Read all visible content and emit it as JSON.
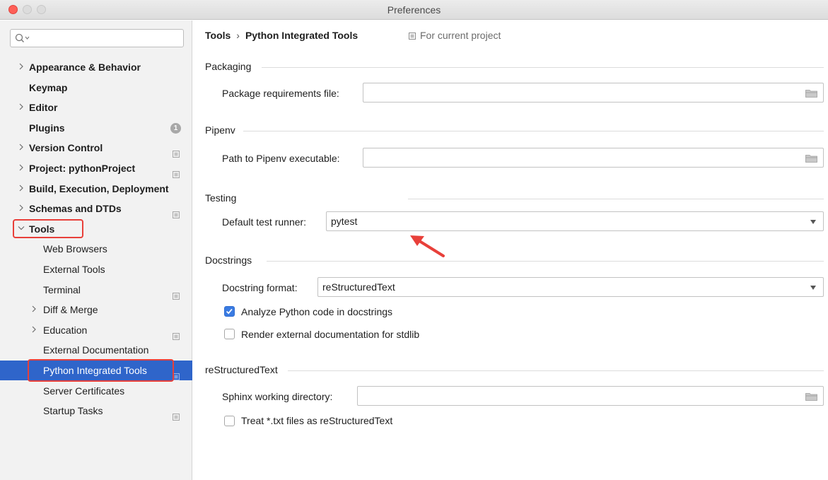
{
  "window": {
    "title": "Preferences"
  },
  "sidebar": {
    "search_placeholder": "",
    "items": [
      {
        "label": "Appearance & Behavior",
        "level": 0,
        "chevron": ">",
        "bold": true
      },
      {
        "label": "Keymap",
        "level": 0,
        "chevron": "",
        "bold": true
      },
      {
        "label": "Editor",
        "level": 0,
        "chevron": ">",
        "bold": true
      },
      {
        "label": "Plugins",
        "level": 0,
        "chevron": "",
        "bold": true,
        "badge": "1"
      },
      {
        "label": "Version Control",
        "level": 0,
        "chevron": ">",
        "bold": true,
        "project_icon": true
      },
      {
        "label": "Project: pythonProject",
        "level": 0,
        "chevron": ">",
        "bold": true,
        "project_icon": true
      },
      {
        "label": "Build, Execution, Deployment",
        "level": 0,
        "chevron": ">",
        "bold": true
      },
      {
        "label": "Schemas and DTDs",
        "level": 0,
        "chevron": ">",
        "bold": true,
        "project_icon": true
      },
      {
        "label": "Tools",
        "level": 0,
        "chevron": "v",
        "bold": true,
        "expanded": true
      },
      {
        "label": "Web Browsers",
        "level": 1,
        "chevron": ""
      },
      {
        "label": "External Tools",
        "level": 1,
        "chevron": ""
      },
      {
        "label": "Terminal",
        "level": 1,
        "chevron": "",
        "project_icon": true
      },
      {
        "label": "Diff & Merge",
        "level": 1,
        "chevron": ">"
      },
      {
        "label": "Education",
        "level": 1,
        "chevron": ">",
        "project_icon": true
      },
      {
        "label": "External Documentation",
        "level": 1,
        "chevron": ""
      },
      {
        "label": "Python Integrated Tools",
        "level": 1,
        "chevron": "",
        "selected": true,
        "project_icon": true
      },
      {
        "label": "Server Certificates",
        "level": 1,
        "chevron": ""
      },
      {
        "label": "Startup Tasks",
        "level": 1,
        "chevron": "",
        "project_icon": true
      }
    ]
  },
  "main": {
    "breadcrumb": {
      "parent": "Tools",
      "separator": "›",
      "current": "Python Integrated Tools"
    },
    "for_current_project": "For current project",
    "packaging": {
      "title": "Packaging",
      "requirements_label": "Package requirements file:",
      "requirements_value": ""
    },
    "pipenv": {
      "title": "Pipenv",
      "path_label": "Path to Pipenv executable:",
      "path_value": ""
    },
    "testing": {
      "title": "Testing",
      "runner_label": "Default test runner:",
      "runner_value": "pytest"
    },
    "docstrings": {
      "title": "Docstrings",
      "format_label": "Docstring format:",
      "format_value": "reStructuredText",
      "analyze_label": "Analyze Python code in docstrings",
      "analyze_checked": true,
      "render_label": "Render external documentation for stdlib",
      "render_checked": false
    },
    "restructuredtext": {
      "title": "reStructuredText",
      "sphinx_label": "Sphinx working directory:",
      "sphinx_value": "",
      "treat_txt_label": "Treat *.txt files as reStructuredText",
      "treat_txt_checked": false
    }
  },
  "colors": {
    "selection": "#2f65ca",
    "checkbox_checked": "#3a7be2",
    "highlight_annotation": "#e8403a"
  }
}
